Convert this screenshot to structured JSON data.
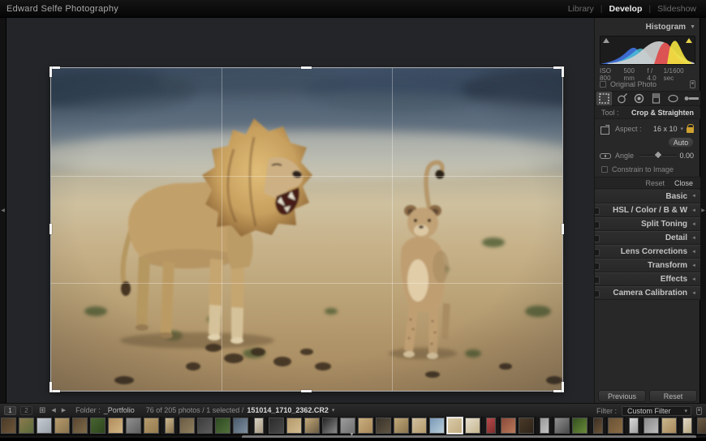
{
  "titlebar": {
    "identity": "Edward Selfe Photography",
    "separator": "|",
    "modules": [
      {
        "label": "Library",
        "active": false
      },
      {
        "label": "Develop",
        "active": true
      },
      {
        "label": "Slideshow",
        "active": false
      }
    ]
  },
  "icons": {
    "histogram_collapse": "▼",
    "panel_collapse": "◄",
    "dropdown": "▾",
    "back": "◀",
    "forward": "▶",
    "grid": "⊞",
    "left_edge": "◀",
    "right_edge": "▶",
    "bottom_edge": "▼"
  },
  "histogram": {
    "title": "Histogram",
    "exif": [
      "ISO 800",
      "500 mm",
      "f / 4.0",
      "1/1600 sec"
    ],
    "original_photo_label": "Original Photo"
  },
  "crop_panel": {
    "tool_label": "Tool :",
    "tool_name": "Crop & Straighten",
    "aspect_label": "Aspect :",
    "aspect_value": "16 x 10",
    "auto_label": "Auto",
    "angle_label": "Angle",
    "angle_value": "0.00",
    "constrain_label": "Constrain to Image",
    "reset_label": "Reset",
    "close_label": "Close"
  },
  "panels": [
    {
      "id": "basic",
      "label": "Basic",
      "toggle": false
    },
    {
      "id": "hsl-color-bw",
      "label": "HSL / Color / B & W",
      "toggle": true
    },
    {
      "id": "split-toning",
      "label": "Split Toning",
      "toggle": true
    },
    {
      "id": "detail",
      "label": "Detail",
      "toggle": true
    },
    {
      "id": "lens-corrections",
      "label": "Lens Corrections",
      "toggle": true
    },
    {
      "id": "transform",
      "label": "Transform",
      "toggle": true
    },
    {
      "id": "effects",
      "label": "Effects",
      "toggle": true
    },
    {
      "id": "camera-calibration",
      "label": "Camera Calibration",
      "toggle": true
    }
  ],
  "footer_buttons": {
    "previous": "Previous",
    "reset": "Reset"
  },
  "statusbar": {
    "monitor_1": "1",
    "monitor_2": "2",
    "folder_label": "Folder :",
    "folder_name": "_Portfolio",
    "selection_info": "76 of 205 photos / 1 selected /",
    "filename": "151014_1710_2362.CR2",
    "filter_label": "Filter :",
    "filter_value": "Custom Filter"
  },
  "colors": {
    "accent_lock": "#cfa12f",
    "clip_highlight": "#e8d44a",
    "hist_blue": "#3f6fd8",
    "hist_cyan": "#4fc3d8",
    "hist_red": "#e04040",
    "hist_yellow": "#f0e040",
    "hist_gray": "#cfcfcf"
  },
  "filmstrip": {
    "thumbs": [
      {
        "c": "#4a3a28",
        "c2": "#6e5639",
        "p": false,
        "sel": false
      },
      {
        "c": "#8a7a4e",
        "c2": "#5a6b3a",
        "p": false,
        "sel": false
      },
      {
        "c": "#c6cbd1",
        "c2": "#9aa2ab",
        "p": false,
        "sel": false
      },
      {
        "c": "#b59a6b",
        "c2": "#8a744e",
        "p": false,
        "sel": false
      },
      {
        "c": "#5a4631",
        "c2": "#7e6a49",
        "p": false,
        "sel": false
      },
      {
        "c": "#47632f",
        "c2": "#2e471f",
        "p": false,
        "sel": false
      },
      {
        "c": "#b18d5b",
        "c2": "#d1b585",
        "p": false,
        "sel": false
      },
      {
        "c": "#8f8f8f",
        "c2": "#606060",
        "p": false,
        "sel": false
      },
      {
        "c": "#b59a6b",
        "c2": "#957b50",
        "p": false,
        "sel": false
      },
      {
        "c": "#c9b68e",
        "c2": "#8a744e",
        "p": true,
        "sel": false
      },
      {
        "c": "#6b5b43",
        "c2": "#90805f",
        "p": false,
        "sel": false
      },
      {
        "c": "#3c3c3c",
        "c2": "#5c5c5c",
        "p": false,
        "sel": false
      },
      {
        "c": "#2f4a22",
        "c2": "#50703a",
        "p": false,
        "sel": false
      },
      {
        "c": "#4a5a6b",
        "c2": "#7e8fa0",
        "p": false,
        "sel": false
      },
      {
        "c": "#d6d0c2",
        "c2": "#a89a80",
        "p": true,
        "sel": false
      },
      {
        "c": "#2c2c2c",
        "c2": "#484848",
        "p": false,
        "sel": false
      },
      {
        "c": "#b59a6b",
        "c2": "#d2bc90",
        "p": false,
        "sel": false
      },
      {
        "c": "#c2a878",
        "c2": "#6b5b43",
        "p": false,
        "sel": false
      },
      {
        "c": "#242424",
        "c2": "#8a8a8a",
        "p": false,
        "sel": false
      },
      {
        "c": "#9c9c9c",
        "c2": "#707070",
        "p": false,
        "sel": false
      },
      {
        "c": "#c9ae7d",
        "c2": "#a8885a",
        "p": false,
        "sel": false
      },
      {
        "c": "#3a332a",
        "c2": "#5f5443",
        "p": false,
        "sel": false
      },
      {
        "c": "#c2a878",
        "c2": "#8a744e",
        "p": false,
        "sel": false
      },
      {
        "c": "#d0c0a0",
        "c2": "#b59a6b",
        "p": false,
        "sel": false
      },
      {
        "c": "#7a9ab8",
        "c2": "#b9cdd9",
        "p": false,
        "sel": false
      },
      {
        "c": "#d9cba9",
        "c2": "#c2ab80",
        "p": false,
        "sel": true
      },
      {
        "c": "#e6decd",
        "c2": "#c6b68e",
        "p": false,
        "sel": false
      },
      {
        "c": "#b84a4a",
        "c2": "#7e2c2c",
        "p": true,
        "sel": false
      },
      {
        "c": "#8a4a3a",
        "c2": "#b87a5a",
        "p": false,
        "sel": false
      },
      {
        "c": "#4a3a28",
        "c2": "#2e241a",
        "p": false,
        "sel": false
      },
      {
        "c": "#9a9a9a",
        "c2": "#c2c2c2",
        "p": true,
        "sel": false
      },
      {
        "c": "#8f8f8f",
        "c2": "#4a4a4a",
        "p": false,
        "sel": false
      },
      {
        "c": "#33511f",
        "c2": "#6b8a3a",
        "p": false,
        "sel": false
      },
      {
        "c": "#3a2f24",
        "c2": "#6b5337",
        "p": true,
        "sel": false
      },
      {
        "c": "#6b5337",
        "c2": "#8a6b43",
        "p": false,
        "sel": false
      },
      {
        "c": "#d8d8d8",
        "c2": "#a0a0a0",
        "p": true,
        "sel": false
      },
      {
        "c": "#8a8a8a",
        "c2": "#bcbcbc",
        "p": false,
        "sel": false
      },
      {
        "c": "#c9b68e",
        "c2": "#a8885a",
        "p": false,
        "sel": false
      },
      {
        "c": "#e0d8c8",
        "c2": "#b8a880",
        "p": true,
        "sel": false
      },
      {
        "c": "#6b5b43",
        "c2": "#3a2d22",
        "p": false,
        "sel": false
      }
    ]
  }
}
